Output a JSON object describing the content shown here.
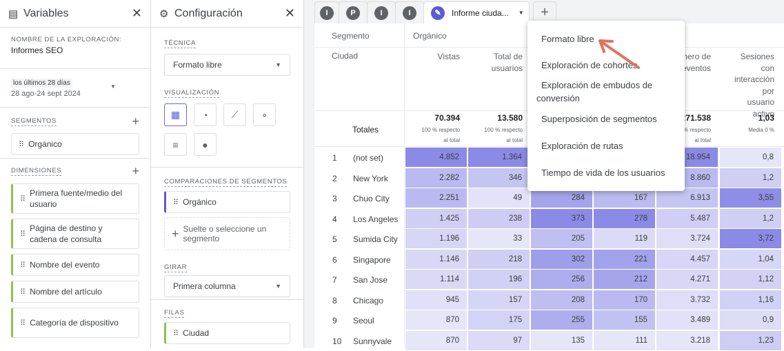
{
  "variables": {
    "title": "Variables",
    "icon": "report-icon",
    "exploration_label": "NOMBRE DE LA EXPLORACIÓN:",
    "exploration_name": "Informes SEO",
    "date_badge": "los últimos 28 días",
    "date_range": "28 ago-24 sept 2024",
    "segments_label": "SEGMENTOS",
    "segments": [
      "Orgánico"
    ],
    "dimensions_label": "DIMENSIONES",
    "dimensions": [
      "Primera fuente/medio del usuario",
      "Página de destino y cadena de consulta",
      "Nombre del evento",
      "Nombre del artículo",
      "Categoría de dispositivo"
    ]
  },
  "config": {
    "title": "Configuración",
    "icon": "gear-icon",
    "technique_label": "TÉCNICA",
    "technique": "Formato libre",
    "viz_label": "VISUALIZACIÓN",
    "viz": [
      "table-icon",
      "donut-icon",
      "line-chart-icon",
      "scatter-icon",
      "bar-chart-icon",
      "globe-icon"
    ],
    "comparisons_label": "COMPARACIONES DE SEGMENTOS",
    "comparison": "Orgánico",
    "drop_hint": "Suelte o seleccione un segmento",
    "pivot_label": "GIRAR",
    "pivot": "Primera columna",
    "rows_label": "FILAS",
    "rows": [
      "Ciudad"
    ]
  },
  "tabs": {
    "items": [
      "I",
      "P",
      "I",
      "I"
    ],
    "active": "Informe ciuda..."
  },
  "table": {
    "segment_label": "Segmento",
    "segment": "Orgánico",
    "dimension": "Ciudad",
    "columns": [
      "Vistas",
      "Total de usuarios",
      "",
      "",
      "Número de eventos",
      "Sesiones con interacción por usuario activo"
    ],
    "totals_label": "Totales",
    "totals": [
      {
        "v": "70.394",
        "s": "100 % respecto al total"
      },
      {
        "v": "13.580",
        "s": "100 % respecto al total"
      },
      {
        "v": "",
        "s": ""
      },
      {
        "v": "",
        "s": ""
      },
      {
        "v": "271.538",
        "s": "100 % respecto al total"
      },
      {
        "v": "1,03",
        "s": "Media 0 %"
      }
    ],
    "rows": [
      {
        "n": "1",
        "city": "(not set)",
        "vals": [
          "4.852",
          "1.364",
          "",
          "",
          "18.954",
          "0,8"
        ]
      },
      {
        "n": "2",
        "city": "New York",
        "vals": [
          "2.282",
          "346",
          "",
          "",
          "8.860",
          "1,2"
        ]
      },
      {
        "n": "3",
        "city": "Chuo City",
        "vals": [
          "2.251",
          "49",
          "284",
          "167",
          "6.913",
          "3,55"
        ]
      },
      {
        "n": "4",
        "city": "Los Angeles",
        "vals": [
          "1.425",
          "238",
          "373",
          "278",
          "5.487",
          "1,2"
        ]
      },
      {
        "n": "5",
        "city": "Sumida City",
        "vals": [
          "1.196",
          "33",
          "205",
          "119",
          "3.724",
          "3,72"
        ]
      },
      {
        "n": "6",
        "city": "Singapore",
        "vals": [
          "1.146",
          "218",
          "302",
          "221",
          "4.457",
          "1,04"
        ]
      },
      {
        "n": "7",
        "city": "San Jose",
        "vals": [
          "1.114",
          "196",
          "256",
          "212",
          "4.271",
          "1,12"
        ]
      },
      {
        "n": "8",
        "city": "Chicago",
        "vals": [
          "945",
          "157",
          "208",
          "170",
          "3.732",
          "1,16"
        ]
      },
      {
        "n": "9",
        "city": "Seoul",
        "vals": [
          "870",
          "175",
          "255",
          "155",
          "3.489",
          "0,9"
        ]
      },
      {
        "n": "10",
        "city": "Sunnyvale",
        "vals": [
          "870",
          "97",
          "135",
          "111",
          "3.218",
          "1,23"
        ]
      }
    ]
  },
  "menu": {
    "items": [
      "Formato libre",
      "Exploración de cohortes",
      "Exploración de embudos de conversión",
      "Superposición de segmentos",
      "Exploración de rutas",
      "Tiempo de vida de los usuarios"
    ]
  },
  "colors": {
    "accent": "#5b5bd6",
    "heat_low": "#e6e6f9",
    "heat_high": "#8b8ae6",
    "arrow": "#e0735f",
    "dimension_bar": "#8bc34a"
  }
}
